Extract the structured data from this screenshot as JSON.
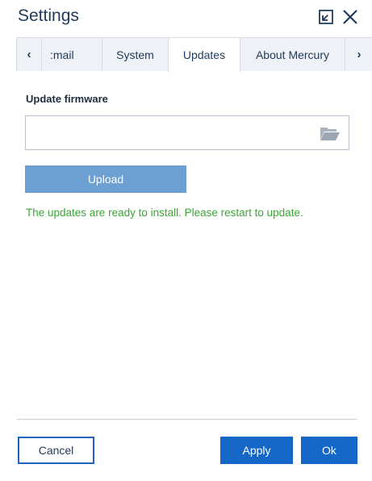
{
  "dialog": {
    "title": "Settings",
    "icons": {
      "minimize": "minimize-to-corner-icon",
      "close": "close-icon"
    }
  },
  "tabs": {
    "prev_arrow": "‹",
    "next_arrow": "›",
    "items": [
      {
        "label": "Email",
        "visible_label": ":mail",
        "active": false
      },
      {
        "label": "System",
        "active": false
      },
      {
        "label": "Updates",
        "active": true
      },
      {
        "label": "About Mercury",
        "active": false
      }
    ]
  },
  "updates": {
    "section_label": "Update firmware",
    "file_input_value": "",
    "folder_icon": "folder-open-icon",
    "upload_label": "Upload",
    "status_message": "The updates are ready to install. Please restart to update."
  },
  "footer": {
    "cancel_label": "Cancel",
    "apply_label": "Apply",
    "ok_label": "Ok"
  },
  "colors": {
    "primary": "#1466c7",
    "upload_button": "#6c9fd2",
    "success_text": "#3aa635",
    "title_text": "#1f3a5a"
  }
}
